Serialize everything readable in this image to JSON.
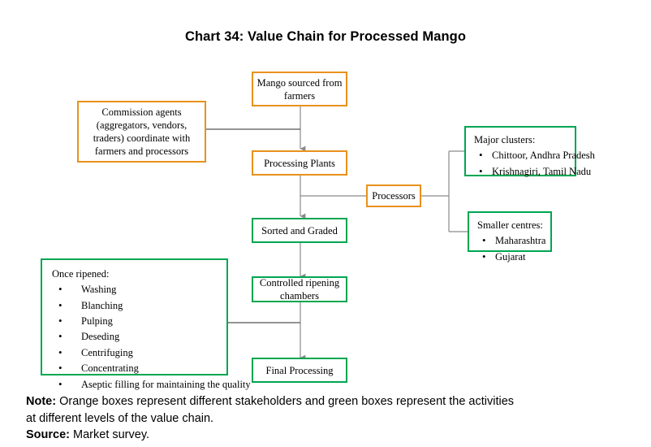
{
  "title": "Chart 34: Value Chain for Processed Mango",
  "colors": {
    "orange": "#E8911C",
    "green": "#00A651",
    "connector": "#808080",
    "text": "#000000",
    "background": "#FFFFFF"
  },
  "nodes": {
    "mango_sourced": {
      "label_line1": "Mango sourced from",
      "label_line2": "farmers",
      "type": "stakeholder"
    },
    "commission_agents": {
      "label_line1": "Commission agents",
      "label_line2": "(aggregators, vendors,",
      "label_line3": "traders) coordinate with",
      "label_line4": "farmers and processors",
      "type": "stakeholder"
    },
    "processing_plants": {
      "label": "Processing Plants",
      "type": "stakeholder"
    },
    "processors": {
      "label": "Processors",
      "type": "stakeholder"
    },
    "major_clusters": {
      "heading": "Major clusters:",
      "items": [
        "Chittoor, Andhra Pradesh",
        "Krishnagiri, Tamil Nadu"
      ],
      "type": "activity"
    },
    "smaller_centres": {
      "heading": "Smaller centres:",
      "items": [
        "Maharashtra",
        "Gujarat"
      ],
      "type": "activity"
    },
    "sorted_graded": {
      "label": "Sorted and Graded",
      "type": "activity"
    },
    "controlled_ripening": {
      "label_line1": "Controlled ripening",
      "label_line2": "chambers",
      "type": "activity"
    },
    "once_ripened": {
      "heading": "Once ripened:",
      "items": [
        "Washing",
        "Blanching",
        "Pulping",
        "Deseding",
        "Centrifuging",
        "Concentrating",
        "Aseptic filling for maintaining the quality"
      ],
      "type": "activity"
    },
    "final_processing": {
      "label": "Final Processing",
      "type": "activity"
    }
  },
  "footer": {
    "note_label": "Note:",
    "note_text_line1": " Orange boxes represent different stakeholders and green boxes represent the activities",
    "note_text_line2": "at different levels of the value chain.",
    "source_label": "Source:",
    "source_text": " Market survey."
  }
}
